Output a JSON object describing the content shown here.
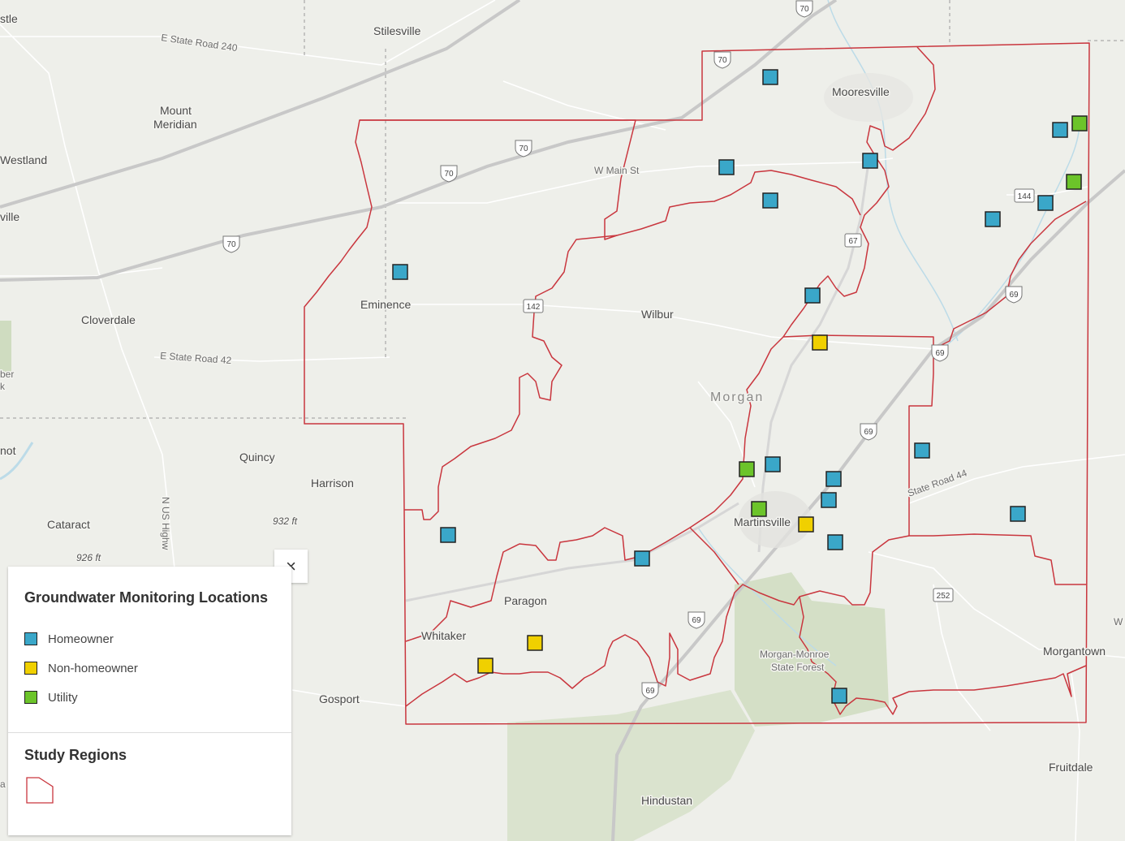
{
  "legend": {
    "close_label": "×",
    "layer1_title": "Groundwater Monitoring Locations",
    "items": [
      {
        "label": "Homeowner",
        "color": "#3aa7c9"
      },
      {
        "label": "Non-homeowner",
        "color": "#f0d000"
      },
      {
        "label": "Utility",
        "color": "#6cc42a"
      }
    ],
    "layer2_title": "Study Regions",
    "region_color": "#c9363e"
  },
  "places": {
    "stilesville": "Stilesville",
    "mount": "Mount",
    "meridian": "Meridian",
    "westland": "Westland",
    "stle": "stle",
    "ville": "ville",
    "cloverdale": "Cloverdale",
    "eminence": "Eminence",
    "wilbur": "Wilbur",
    "morgan": "Morgan",
    "quincy": "Quincy",
    "harrison": "Harrison",
    "cataract": "Cataract",
    "paragon": "Paragon",
    "whitaker": "Whitaker",
    "martinsville": "Martinsville",
    "gosport": "Gosport",
    "mooresville": "Mooresville",
    "morgan_monroe_1": "Morgan-Monroe",
    "morgan_monroe_2": "State Forest",
    "morgantown": "Morgantown",
    "fruitdale": "Fruitdale",
    "hindustan": "Hindustan",
    "ber": "ber",
    "k": "k",
    "not": "not",
    "w": "W",
    "a": "a"
  },
  "roads": {
    "state_road_240": "E State Road 240",
    "w_main_st": "W Main St",
    "state_road_42": "E State Road 42",
    "state_road_44": "State Road 44",
    "us_highway": "N US Highw"
  },
  "elevations": {
    "e1": "932 ft",
    "e2": "926 ft"
  },
  "shields": [
    "70",
    "70",
    "70",
    "70",
    "70",
    "142",
    "67",
    "144",
    "69",
    "69",
    "69",
    "69",
    "69",
    "252"
  ]
}
